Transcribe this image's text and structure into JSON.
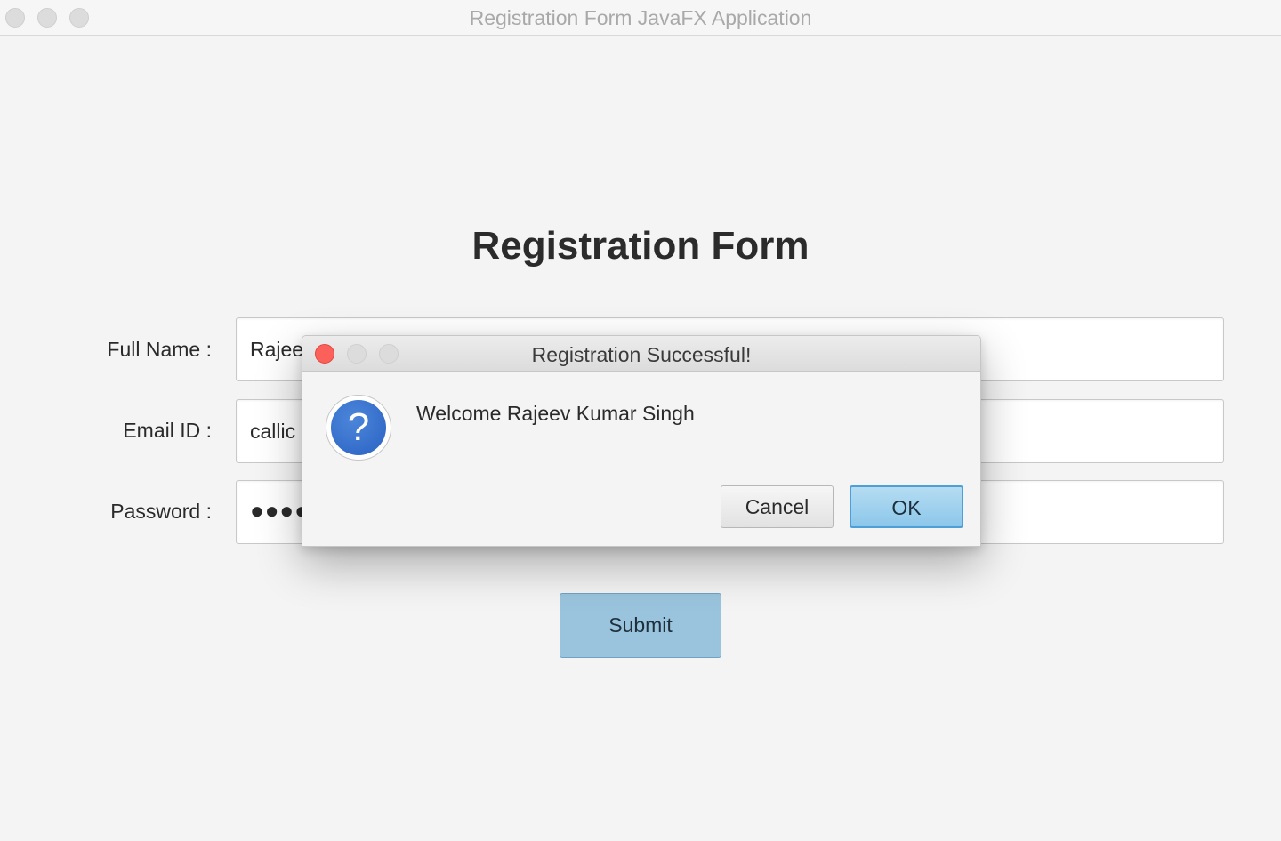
{
  "window": {
    "title": "Registration Form JavaFX Application"
  },
  "form": {
    "heading": "Registration Form",
    "fields": [
      {
        "label": "Full Name :",
        "value": "Rajee"
      },
      {
        "label": "Email ID :",
        "value": "callic"
      },
      {
        "label": "Password :",
        "value": "●●●●"
      }
    ],
    "submit_label": "Submit"
  },
  "dialog": {
    "title": "Registration Successful!",
    "message": "Welcome Rajeev Kumar Singh",
    "icon": "question-icon",
    "icon_glyph": "?",
    "cancel_label": "Cancel",
    "ok_label": "OK"
  },
  "colors": {
    "background": "#f4f4f4",
    "submit_button": "#9ac4dd",
    "ok_button": "#8cc7ea",
    "close_light": "#fc605b",
    "question_icon": "#2a62c2"
  }
}
